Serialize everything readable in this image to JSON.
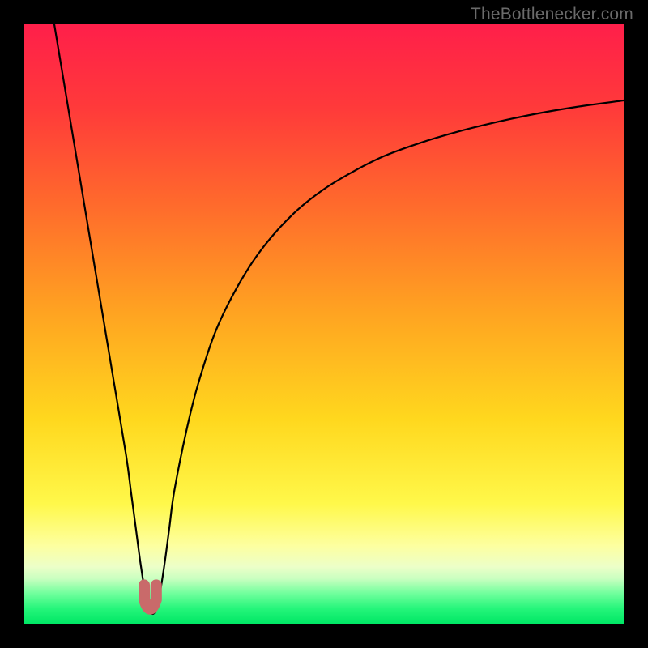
{
  "attribution": "TheBottlenecker.com",
  "colors": {
    "frame": "#000000",
    "curve": "#000000",
    "marker_fill": "#c96a6a",
    "marker_stroke": "#b25656",
    "gradient_stops": [
      {
        "offset": 0.0,
        "color": "#ff1f4a"
      },
      {
        "offset": 0.14,
        "color": "#ff3a3a"
      },
      {
        "offset": 0.3,
        "color": "#ff6a2c"
      },
      {
        "offset": 0.48,
        "color": "#ffa321"
      },
      {
        "offset": 0.66,
        "color": "#ffd81e"
      },
      {
        "offset": 0.8,
        "color": "#fff84a"
      },
      {
        "offset": 0.87,
        "color": "#fdffa0"
      },
      {
        "offset": 0.905,
        "color": "#ecffc8"
      },
      {
        "offset": 0.925,
        "color": "#c9ffc0"
      },
      {
        "offset": 0.95,
        "color": "#6fff9c"
      },
      {
        "offset": 0.975,
        "color": "#25f57a"
      },
      {
        "offset": 1.0,
        "color": "#00e765"
      }
    ]
  },
  "chart_data": {
    "type": "line",
    "title": "",
    "xlabel": "",
    "ylabel": "",
    "xlim": [
      0,
      100
    ],
    "ylim": [
      0,
      100
    ],
    "series": [
      {
        "name": "bottleneck-curve",
        "x": [
          5,
          7,
          9,
          11,
          13,
          15,
          17,
          17.8,
          18.6,
          19.4,
          20.2,
          21,
          21.8,
          22.6,
          23.4,
          24.2,
          25,
          27,
          29,
          32,
          36,
          40,
          45,
          50,
          55,
          60,
          66,
          72,
          78,
          85,
          92,
          100
        ],
        "y": [
          100,
          88,
          76,
          64,
          52,
          40,
          28,
          22,
          16,
          10,
          5,
          2,
          2,
          5,
          10,
          16,
          22,
          32,
          40,
          49,
          57,
          63,
          68.5,
          72.5,
          75.5,
          78,
          80.2,
          82,
          83.5,
          85,
          86.2,
          87.3
        ]
      }
    ],
    "markers": [
      {
        "name": "u-left",
        "x": 20.0,
        "y": 4.0
      },
      {
        "name": "u-bottom",
        "x": 21.0,
        "y": 2.0
      },
      {
        "name": "u-right",
        "x": 22.0,
        "y": 4.0
      }
    ],
    "annotations": []
  }
}
